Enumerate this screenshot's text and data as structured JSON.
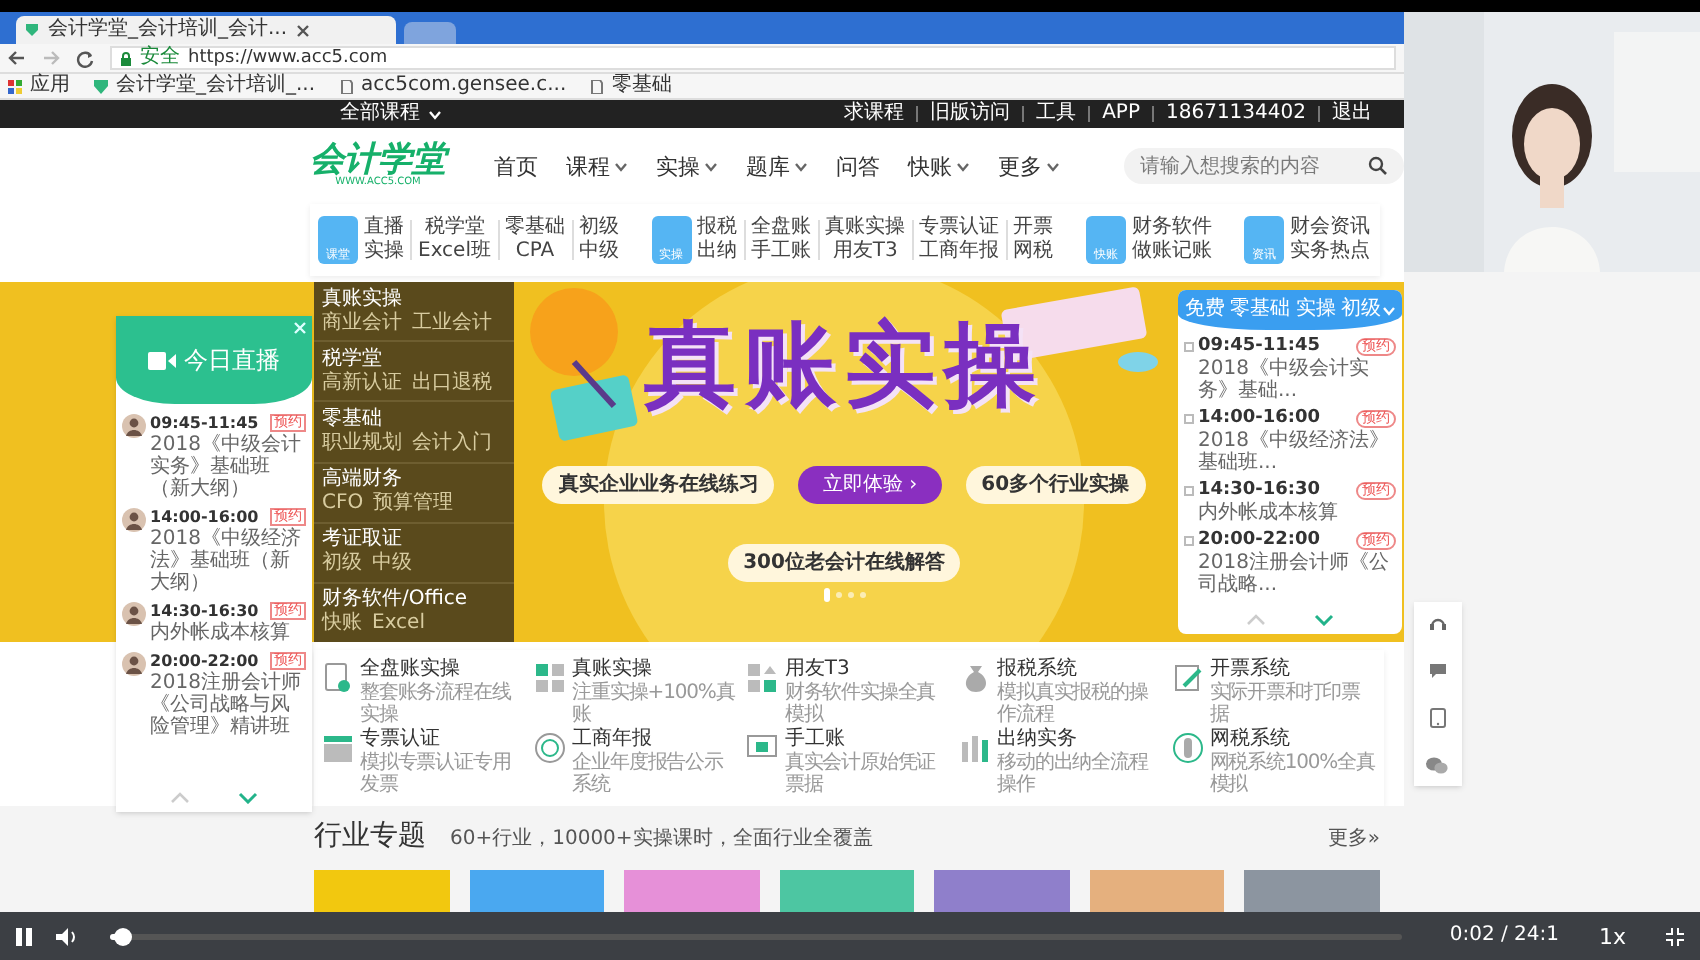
{
  "browser": {
    "tab_title": "会计学堂_会计培训_会计...",
    "secure_label": "安全",
    "address": "https://www.acc5.com",
    "bookmarks": [
      "应用",
      "会计学堂_会计培训_...",
      "acc5com.gensee.c...",
      "零基础"
    ]
  },
  "site_top": {
    "all_courses": "全部课程",
    "links": [
      "求课程",
      "旧版访问",
      "工具",
      "APP",
      "18671134402",
      "退出"
    ]
  },
  "header": {
    "logo": "会计学堂",
    "logo_sub": "WWW.ACC5.COM",
    "nav": [
      {
        "label": "首页",
        "dropdown": false
      },
      {
        "label": "课程",
        "dropdown": true
      },
      {
        "label": "实操",
        "dropdown": true
      },
      {
        "label": "题库",
        "dropdown": true
      },
      {
        "label": "问答",
        "dropdown": false
      },
      {
        "label": "快账",
        "dropdown": true
      },
      {
        "label": "更多",
        "dropdown": true
      }
    ],
    "search_placeholder": "请输入想搜索的内容"
  },
  "categories": [
    {
      "badge": "课堂",
      "links": [
        [
          "直播",
          "实操"
        ],
        [
          "税学堂",
          "Excel班"
        ],
        [
          "零基础",
          "CPA"
        ],
        [
          "初级",
          "中级"
        ]
      ]
    },
    {
      "badge": "实操",
      "links": [
        [
          "报税",
          "出纳"
        ],
        [
          "全盘账",
          "手工账"
        ],
        [
          "真账实操",
          "用友T3"
        ],
        [
          "专票认证",
          "工商年报"
        ],
        [
          "开票",
          "网税"
        ]
      ]
    },
    {
      "badge": "快账",
      "links": [
        [
          "财务软件",
          "做账记账"
        ]
      ]
    },
    {
      "badge": "资讯",
      "links": [
        [
          "财会资讯",
          "实务热点"
        ]
      ]
    }
  ],
  "live_panel": {
    "title": "今日直播",
    "items": [
      {
        "time": "09:45-11:45",
        "text": "2018《中级会计实务》基础班（新大纲）",
        "tag": "预约"
      },
      {
        "time": "14:00-16:00",
        "text": "2018《中级经济法》基础班（新大纲）",
        "tag": "预约"
      },
      {
        "time": "14:30-16:30",
        "text": "内外帐成本核算",
        "tag": "预约"
      },
      {
        "time": "20:00-22:00",
        "text": "2018注册会计师《公司战略与风险管理》精讲班",
        "tag": "预约"
      }
    ]
  },
  "menu": [
    {
      "title": "真账实操",
      "subs": [
        "商业会计",
        "工业会计"
      ]
    },
    {
      "title": "税学堂",
      "subs": [
        "高新认证",
        "出口退税"
      ]
    },
    {
      "title": "零基础",
      "subs": [
        "职业规划",
        "会计入门"
      ]
    },
    {
      "title": "高端财务",
      "subs": [
        "CFO",
        "预算管理"
      ]
    },
    {
      "title": "考证取证",
      "subs": [
        "初级",
        "中级"
      ]
    },
    {
      "title": "财务软件/Office",
      "subs": [
        "快账",
        "Excel"
      ]
    }
  ],
  "banner": {
    "headline": "真账实操",
    "pill_left": "**真实**企业业务在线练习",
    "button": "立即体验 ›",
    "pill_right": "**60**多个行业实操",
    "caption": "**300**位老会计在线解答",
    "dots": [
      {
        "selected": true
      },
      {
        "selected": false
      },
      {
        "selected": false
      },
      {
        "selected": false
      }
    ]
  },
  "schedule_panel": {
    "tabs": [
      {
        "label": "免费",
        "dropdown": false
      },
      {
        "label": "零基础",
        "dropdown": false
      },
      {
        "label": "实操",
        "dropdown": false
      },
      {
        "label": "初级",
        "dropdown": true
      }
    ],
    "items": [
      {
        "time": "09:45-11:45",
        "text": "2018《中级会计实务》基础...",
        "tag": "预约"
      },
      {
        "time": "14:00-16:00",
        "text": "2018《中级经济法》基础班...",
        "tag": "预约"
      },
      {
        "time": "14:30-16:30",
        "text": "内外帐成本核算",
        "tag": "预约"
      },
      {
        "time": "20:00-22:00",
        "text": "2018注册会计师《公司战略...",
        "tag": "预约"
      }
    ]
  },
  "features": [
    {
      "title": "全盘账实操",
      "desc": "整套账务流程在线实操"
    },
    {
      "title": "真账实操",
      "desc": "注重实操+100%真账"
    },
    {
      "title": "用友T3",
      "desc": "财务软件实操全真模拟"
    },
    {
      "title": "报税系统",
      "desc": "模拟真实报税的操作流程"
    },
    {
      "title": "开票系统",
      "desc": "实际开票和打印票据"
    },
    {
      "title": "专票认证",
      "desc": "模拟专票认证专用发票"
    },
    {
      "title": "工商年报",
      "desc": "企业年度报告公示系统"
    },
    {
      "title": "手工账",
      "desc": "真实会计原始凭证票据"
    },
    {
      "title": "出纳实务",
      "desc": "移动的出纳全流程操作"
    },
    {
      "title": "网税系统",
      "desc": "网税系统100%全真模拟"
    }
  ],
  "industry": {
    "title": "行业专题",
    "subtitle": "60+行业，10000+实操课时，全面行业全覆盖",
    "more": "更多»",
    "cards": [
      {
        "color": "#f2c80f"
      },
      {
        "color": "#4aa8f0"
      },
      {
        "color": "#e690d8"
      },
      {
        "color": "#4dc6a2"
      },
      {
        "color": "#8f7fcb"
      },
      {
        "color": "#e5b07e"
      },
      {
        "color": "#8c95a0"
      }
    ]
  },
  "player": {
    "level": 0.01,
    "time": "0:02 / 24:1",
    "speed": "1x"
  }
}
